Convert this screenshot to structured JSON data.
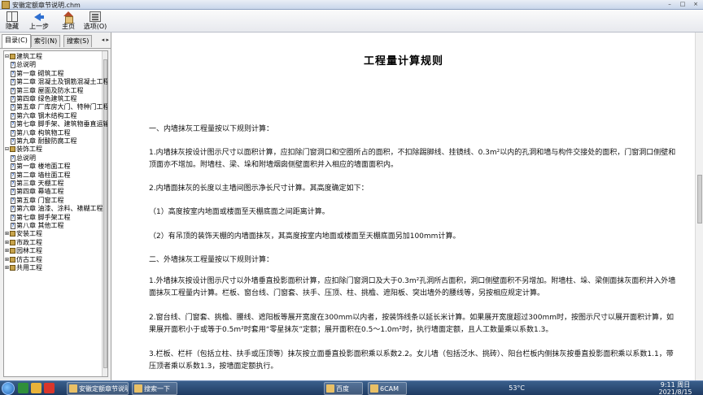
{
  "window": {
    "title": "安徽定额章节说明.chm",
    "controls": [
      "–",
      "□",
      "×"
    ]
  },
  "toolbar": {
    "buttons": [
      {
        "label": "隐藏",
        "icon": "hide-pane-icon"
      },
      {
        "label": "上一步",
        "icon": "back-arrow-icon"
      },
      {
        "label": "主页",
        "icon": "home-icon"
      },
      {
        "label": "选项(O)",
        "icon": "options-icon"
      }
    ]
  },
  "nav": {
    "tabs": [
      "目录(C)",
      "索引(N)",
      "搜索(S)"
    ],
    "tab_scroll": "◂ ▸",
    "tree": [
      {
        "label": "建筑工程",
        "level": 0,
        "type": "book",
        "glyph": "⊟"
      },
      {
        "label": "总说明",
        "level": 1,
        "type": "doc"
      },
      {
        "label": "第一章  砌筑工程",
        "level": 1,
        "type": "doc"
      },
      {
        "label": "第二章  混凝土及钢筋混凝土工程",
        "level": 1,
        "type": "doc"
      },
      {
        "label": "第三章  屋面及防水工程",
        "level": 1,
        "type": "doc"
      },
      {
        "label": "第四章  绿色建筑工程",
        "level": 1,
        "type": "doc"
      },
      {
        "label": "第五章  厂库房大门、特种门工程",
        "level": 1,
        "type": "doc"
      },
      {
        "label": "第六章  钢木结构工程",
        "level": 1,
        "type": "doc"
      },
      {
        "label": "第七章  脚手架、建筑物垂直运输",
        "level": 1,
        "type": "doc"
      },
      {
        "label": "第八章  构筑物工程",
        "level": 1,
        "type": "doc"
      },
      {
        "label": "第九章  耐酸防腐工程",
        "level": 1,
        "type": "doc"
      },
      {
        "label": "装饰工程",
        "level": 0,
        "type": "book",
        "glyph": "⊟"
      },
      {
        "label": "总说明",
        "level": 1,
        "type": "doc"
      },
      {
        "label": "第一章  楼地面工程",
        "level": 1,
        "type": "doc"
      },
      {
        "label": "第二章  墙柱面工程",
        "level": 1,
        "type": "doc"
      },
      {
        "label": "第三章  天棚工程",
        "level": 1,
        "type": "doc"
      },
      {
        "label": "第四章  幕墙工程",
        "level": 1,
        "type": "doc"
      },
      {
        "label": "第五章  门窗工程",
        "level": 1,
        "type": "doc"
      },
      {
        "label": "第六章  油漆、涂料、裱糊工程",
        "level": 1,
        "type": "doc"
      },
      {
        "label": "第七章  脚手架工程",
        "level": 1,
        "type": "doc"
      },
      {
        "label": "第八章  其他工程",
        "level": 1,
        "type": "doc"
      },
      {
        "label": "安装工程",
        "level": 0,
        "type": "book",
        "glyph": "⊞"
      },
      {
        "label": "市政工程",
        "level": 0,
        "type": "book",
        "glyph": "⊞"
      },
      {
        "label": "园林工程",
        "level": 0,
        "type": "book",
        "glyph": "⊞"
      },
      {
        "label": "仿古工程",
        "level": 0,
        "type": "book",
        "glyph": "⊞"
      },
      {
        "label": "共用工程",
        "level": 0,
        "type": "book",
        "glyph": "⊞"
      }
    ]
  },
  "content": {
    "title": "工程量计算规则",
    "paragraphs": [
      "一、内墙抹灰工程量按以下规则计算：",
      "1.内墙抹灰按设计图示尺寸以面积计算，应扣除门窗洞口和空圈所占的面积，不扣除踢脚线、挂镜线、0.3m²以内的孔洞和墙与构件交接处的面积，门窗洞口侧壁和顶面亦不增加。附墙柱、梁、垛和附墙烟囱侧壁面积并入相应的墙面面积内。",
      "2.内墙面抹灰的长度以主墙间图示净长尺寸计算。其高度确定如下：",
      "（1）高度按室内地面或楼面至天棚底面之间距离计算。",
      "（2）有吊顶的装饰天棚的内墙面抹灰，其高度按室内地面或楼面至天棚底面另加100mm计算。",
      "二、外墙抹灰工程量按以下规则计算：",
      "1.外墙抹灰按设计图示尺寸以外墙垂直投影面积计算，应扣除门窗洞口及大于0.3m²孔洞所占面积，洞口侧壁面积不另增加。附墙柱、垛、梁侧面抹灰面积并入外墙面抹灰工程量内计算。栏板、窗台线、门窗套、扶手、压顶、柱、挑檐、遮阳板、突出墙外的腰线等，另按相应规定计算。",
      "2.窗台线、门窗套、挑檐、腰线、遮阳板等展开宽度在300mm以内者，按装饰线条以延长米计算。如果展开宽度超过300mm时，按图示尺寸以展开面积计算，如果展开面积小于或等于0.5m²时套用“零星抹灰”定额；展开面积在0.5～1.0m²时，执行墙面定额，且人工数量乘以系数1.3。",
      "3.栏板、栏杆（包括立柱、扶手或压顶等）抹灰按立面垂直投影面积乘以系数2.2。女儿墙（包括泛水、挑砖）、阳台栏板内侧抹灰按垂直投影面积乘以系数1.1，带压顶者乘以系数1.3，按墙面定额执行。"
    ]
  },
  "taskbar": {
    "tasks": [
      "搜索一下",
      "安徽定额章节说明",
      "百度",
      "6CAM"
    ],
    "temperature": "53°C",
    "time": "9:11 周日",
    "date": "2021/8/15"
  }
}
